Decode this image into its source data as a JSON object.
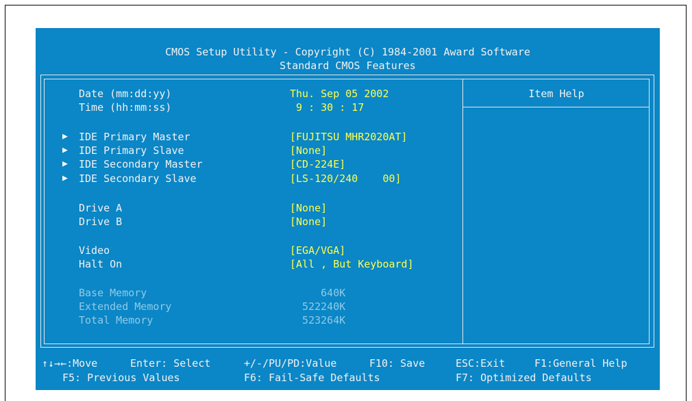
{
  "header": {
    "title": "CMOS Setup Utility - Copyright (C) 1984-2001 Award Software",
    "subtitle": "Standard CMOS Features"
  },
  "help": {
    "title": "Item Help"
  },
  "fields": {
    "date_label": "Date (mm:dd:yy)",
    "date_value": "Thu. Sep 05 2002",
    "time_label": "Time (hh:mm:ss)",
    "time_value": " 9 : 30 : 17",
    "ide_pm_label": "IDE Primary Master",
    "ide_pm_value": "[FUJITSU MHR2020AT]",
    "ide_ps_label": "IDE Primary Slave",
    "ide_ps_value": "[None]",
    "ide_sm_label": "IDE Secondary Master",
    "ide_sm_value": "[CD-224E]",
    "ide_ss_label": "IDE Secondary Slave",
    "ide_ss_value": "[LS-120/240    00]",
    "drive_a_label": "Drive A",
    "drive_a_value": "[None]",
    "drive_b_label": "Drive B",
    "drive_b_value": "[None]",
    "video_label": "Video",
    "video_value": "[EGA/VGA]",
    "halt_label": "Halt On",
    "halt_value": "[All , But Keyboard]",
    "base_mem_label": "Base Memory",
    "base_mem_value": "     640K",
    "ext_mem_label": "Extended Memory",
    "ext_mem_value": "  522240K",
    "total_mem_label": "Total Memory",
    "total_mem_value": "  523264K"
  },
  "arrow_glyph": "▶",
  "footer": {
    "line1_nav": "↑↓→←:Move",
    "line1_enter": "Enter: Select",
    "line1_value": "+/-/PU/PD:Value",
    "line1_save": "F10: Save",
    "line1_exit": "ESC:Exit",
    "line1_help": "F1:General Help",
    "line2_prev": "F5: Previous Values",
    "line2_failsafe": "F6: Fail-Safe Defaults",
    "line2_optimized": "F7: Optimized Defaults"
  },
  "colors": {
    "background": "#0b86c6",
    "value_text": "#ffff4d",
    "label_text": "#f2f2f2",
    "disabled_text": "#8fcbe8"
  }
}
